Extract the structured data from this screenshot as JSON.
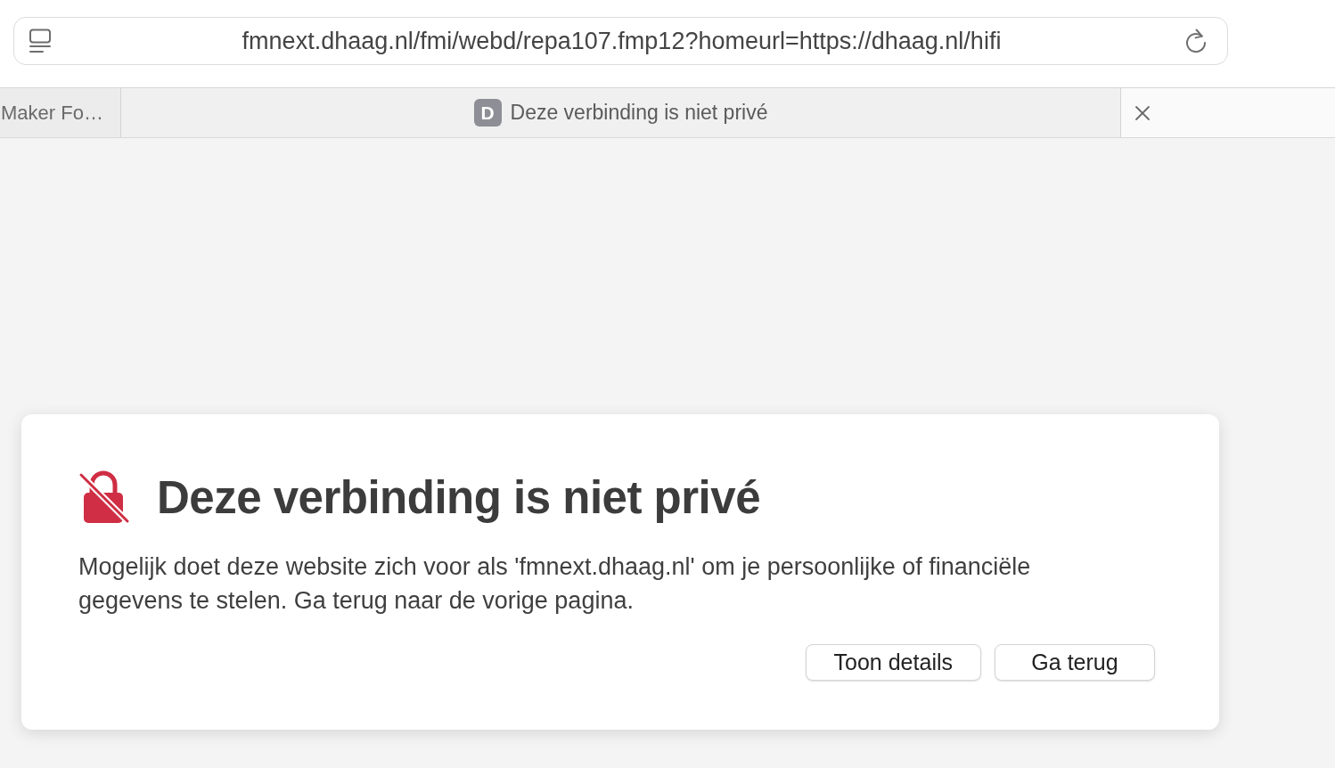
{
  "address_bar": {
    "url": "fmnext.dhaag.nl/fmi/webd/repa107.fmp12?homeurl=https://dhaag.nl/hifi"
  },
  "tabs": [
    {
      "title": "Maker Fo…",
      "selected": false
    },
    {
      "title": "Deze verbinding is niet privé",
      "favicon": "D",
      "selected": true
    }
  ],
  "warning": {
    "title": "Deze verbinding is niet privé",
    "message": "Mogelijk doet deze website zich voor als 'fmnext.dhaag.nl' om je persoonlijke of financiële gegevens te stelen. Ga terug naar de vorige pagina.",
    "buttons": [
      {
        "label": "Toon details"
      },
      {
        "label": "Ga terug"
      }
    ]
  }
}
